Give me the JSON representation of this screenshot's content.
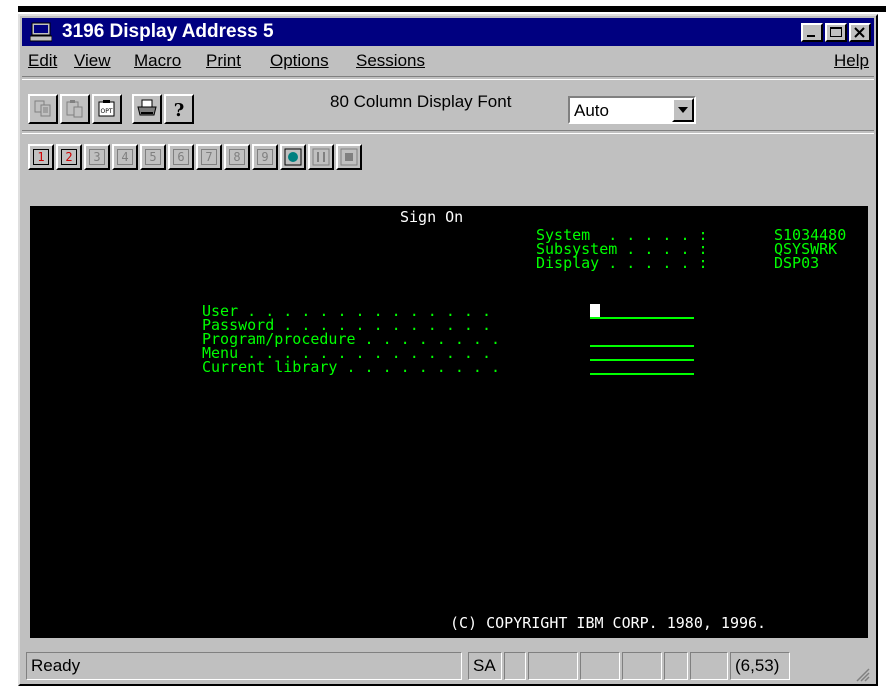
{
  "window": {
    "title": "3196 Display Address 5"
  },
  "menu": {
    "items": [
      "Edit",
      "View",
      "Macro",
      "Print",
      "Options",
      "Sessions"
    ],
    "help": "Help"
  },
  "toolbar": {
    "font_label": "80 Column Display Font",
    "font_select_value": "Auto"
  },
  "sessions": {
    "buttons": [
      "1",
      "2",
      "3",
      "4",
      "5",
      "6",
      "7",
      "8",
      "9"
    ]
  },
  "screen": {
    "heading": "Sign On",
    "system_label": "System  . . . . . :",
    "system_value": "S1034480",
    "subsystem_label": "Subsystem . . . . :",
    "subsystem_value": "QSYSWRK",
    "display_label": "Display . . . . . :",
    "display_value": "DSP03",
    "fields": [
      "User . . . . . . . . . . . . . .",
      "Password . . . . . . . . . . . .",
      "Program/procedure . . . . . . . .",
      "Menu . . . . . . . . . . . . . .",
      "Current library . . . . . . . . ."
    ],
    "copyright": "(C) COPYRIGHT IBM CORP. 1980, 1996."
  },
  "status": {
    "ready": "Ready",
    "mode": "SA",
    "cursor_position": "(6,53)"
  },
  "colors": {
    "title_bar": "#000080",
    "chrome": "#c0c0c0",
    "terminal_bg": "#000000",
    "terminal_green": "#00ff00",
    "terminal_white": "#ffffff"
  }
}
